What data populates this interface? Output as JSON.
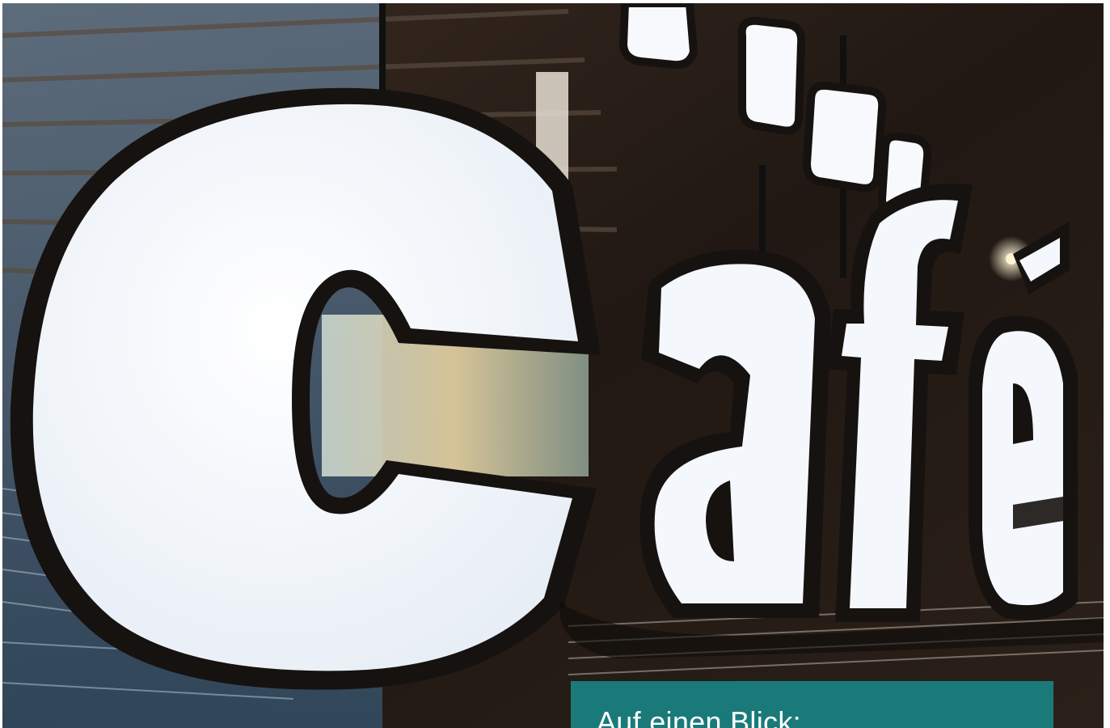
{
  "photo": {
    "subject": "illuminated-cafe-sign",
    "sign_text": "Café",
    "colors": {
      "letter_face": "#f4f7fb",
      "letter_rim": "#161210",
      "background_dark": "#241a14",
      "glass_blue": "#5c88b0",
      "warm_light": "#f0c98a"
    }
  },
  "info_box": {
    "heading": "Auf einen Blick:",
    "background_color": "#1a7a7a"
  }
}
